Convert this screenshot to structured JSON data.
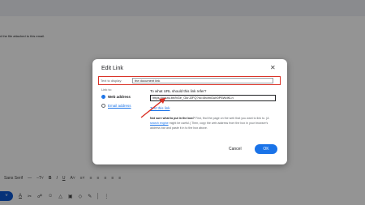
{
  "background": {
    "body_text": "d the file attached to this email.",
    "format_bar": {
      "font": "Sans Serif",
      "items": [
        "—",
        "–T˅",
        "B",
        "I",
        "U",
        "A˅",
        "≡˅",
        "≡",
        "≡",
        "≡",
        "≡",
        "≡"
      ]
    },
    "send_row": {
      "send_label": "˅",
      "items": [
        "A",
        "✂",
        "☍",
        "☺",
        "△",
        "▣",
        "◇",
        "✎",
        "⋮"
      ]
    }
  },
  "dialog": {
    "title": "Edit Link",
    "close": "✕",
    "text_to_display_label": "Text to display:",
    "text_to_display_value": "the document link",
    "link_to_label": "Link to:",
    "options": [
      {
        "label": "Web address",
        "selected": true
      },
      {
        "label": "Email address",
        "selected": false
      }
    ],
    "url_question": "To what URL should this link refer?",
    "url_value": "https://youtu.be/bGe_GkrJ2FQ?si=4hdmGuh0P6WdKLn",
    "test_link": "Test this link",
    "help": {
      "bold": "Not sure what to put in the box?",
      "part1": " First, find the page on the web that you want to link to. (A ",
      "link": "search engine",
      "part2": " might be useful.) Then, copy the web address from the box in your browser's address bar and paste it in to the box above."
    },
    "cancel_label": "Cancel",
    "ok_label": "OK"
  },
  "colors": {
    "accent": "#1a73e8",
    "highlight": "#d93025"
  }
}
